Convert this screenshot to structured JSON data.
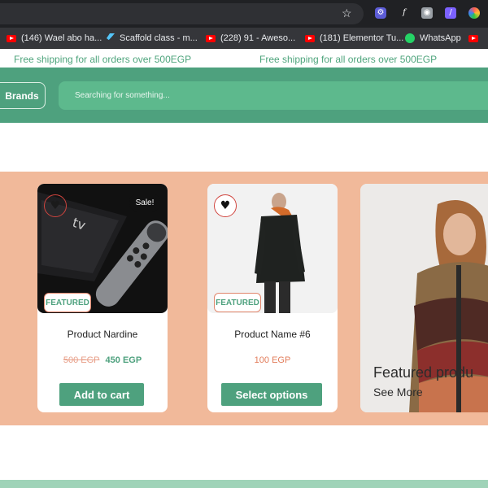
{
  "browser": {
    "bookmarks": [
      {
        "icon": "youtube-icon",
        "label": "(146) Wael abo ha..."
      },
      {
        "icon": "flutter-icon",
        "label": "Scaffold class - m..."
      },
      {
        "icon": "youtube-icon",
        "label": "(228) 91 - Aweso..."
      },
      {
        "icon": "youtube-icon",
        "label": "(181) Elementor Tu..."
      },
      {
        "icon": "whatsapp-icon",
        "label": "WhatsApp"
      }
    ],
    "extension_icons": [
      "gear-extension-icon",
      "font-extension-icon",
      "camera-extension-icon",
      "slash-extension-icon",
      "color-extension-icon"
    ],
    "colors": {
      "chrome_dark": "#202124",
      "bookmark_bar": "#35363a"
    }
  },
  "announcement": {
    "text_1": "Free shipping for all orders over 500EGP",
    "text_2": "Free shipping for all orders over 500EGP"
  },
  "header": {
    "brands_label": "Brands",
    "search_placeholder": "Searching for something..."
  },
  "products": [
    {
      "name": "Product Nardine",
      "old_price": "500 EGP",
      "price": "450 EGP",
      "badge": "Sale!",
      "tag": "FEATURED",
      "button": "Add to cart",
      "wishlisted": false
    },
    {
      "name": "Product Name #6",
      "price": "100 EGP",
      "tag": "FEATURED",
      "button": "Select options",
      "wishlisted": true
    }
  ],
  "promo": {
    "title": "Featured produ",
    "link": "See More"
  },
  "colors": {
    "brand_green": "#4ea17e",
    "peach": "#f1b99a",
    "sale_red": "#e27c5a"
  }
}
